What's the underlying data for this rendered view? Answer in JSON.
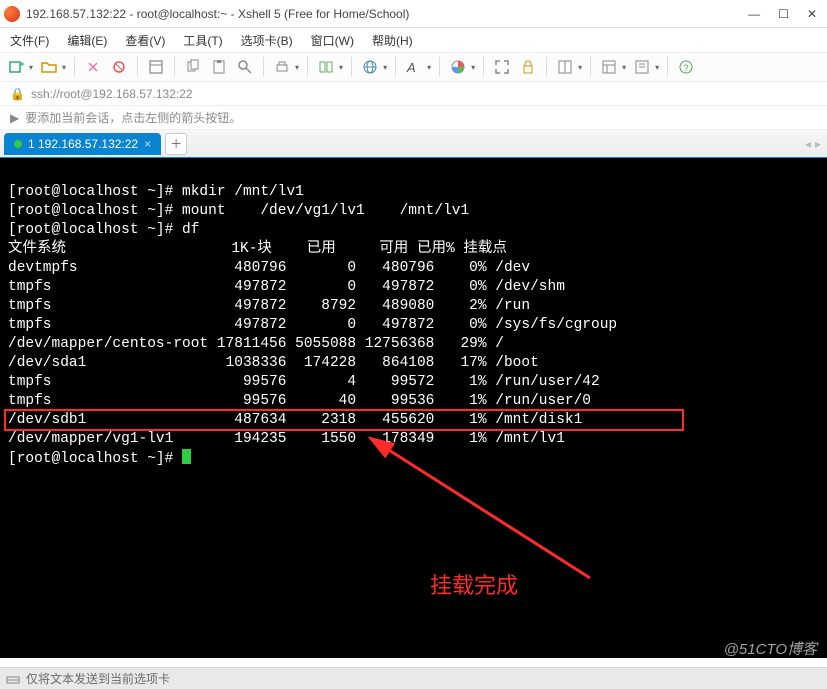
{
  "window": {
    "title": "192.168.57.132:22 - root@localhost:~ - Xshell 5 (Free for Home/School)"
  },
  "menu": {
    "file": "文件(F)",
    "edit": "编辑(E)",
    "view": "查看(V)",
    "tools": "工具(T)",
    "tabs": "选项卡(B)",
    "window": "窗口(W)",
    "help": "帮助(H)"
  },
  "address": {
    "text": "ssh://root@192.168.57.132:22"
  },
  "tip": {
    "text": "要添加当前会话，点击左侧的箭头按钮。"
  },
  "tab": {
    "label": "1 192.168.57.132:22"
  },
  "terminal": {
    "lines": [
      "[root@localhost ~]# mkdir /mnt/lv1",
      "[root@localhost ~]# mount    /dev/vg1/lv1    /mnt/lv1",
      "[root@localhost ~]# df",
      "文件系统                   1K-块    已用     可用 已用% 挂载点",
      "devtmpfs                  480796       0   480796    0% /dev",
      "tmpfs                     497872       0   497872    0% /dev/shm",
      "tmpfs                     497872    8792   489080    2% /run",
      "tmpfs                     497872       0   497872    0% /sys/fs/cgroup",
      "/dev/mapper/centos-root 17811456 5055088 12756368   29% /",
      "/dev/sda1                1038336  174228   864108   17% /boot",
      "tmpfs                      99576       4    99572    1% /run/user/42",
      "tmpfs                      99576      40    99536    1% /run/user/0",
      "/dev/sdb1                 487634    2318   455620    1% /mnt/disk1",
      "/dev/mapper/vg1-lv1       194235    1550   178349    1% /mnt/lv1",
      "[root@localhost ~]# "
    ],
    "annotation": "挂载完成"
  },
  "status": {
    "text": "仅将文本发送到当前选项卡"
  },
  "watermark": "@51CTO博客"
}
